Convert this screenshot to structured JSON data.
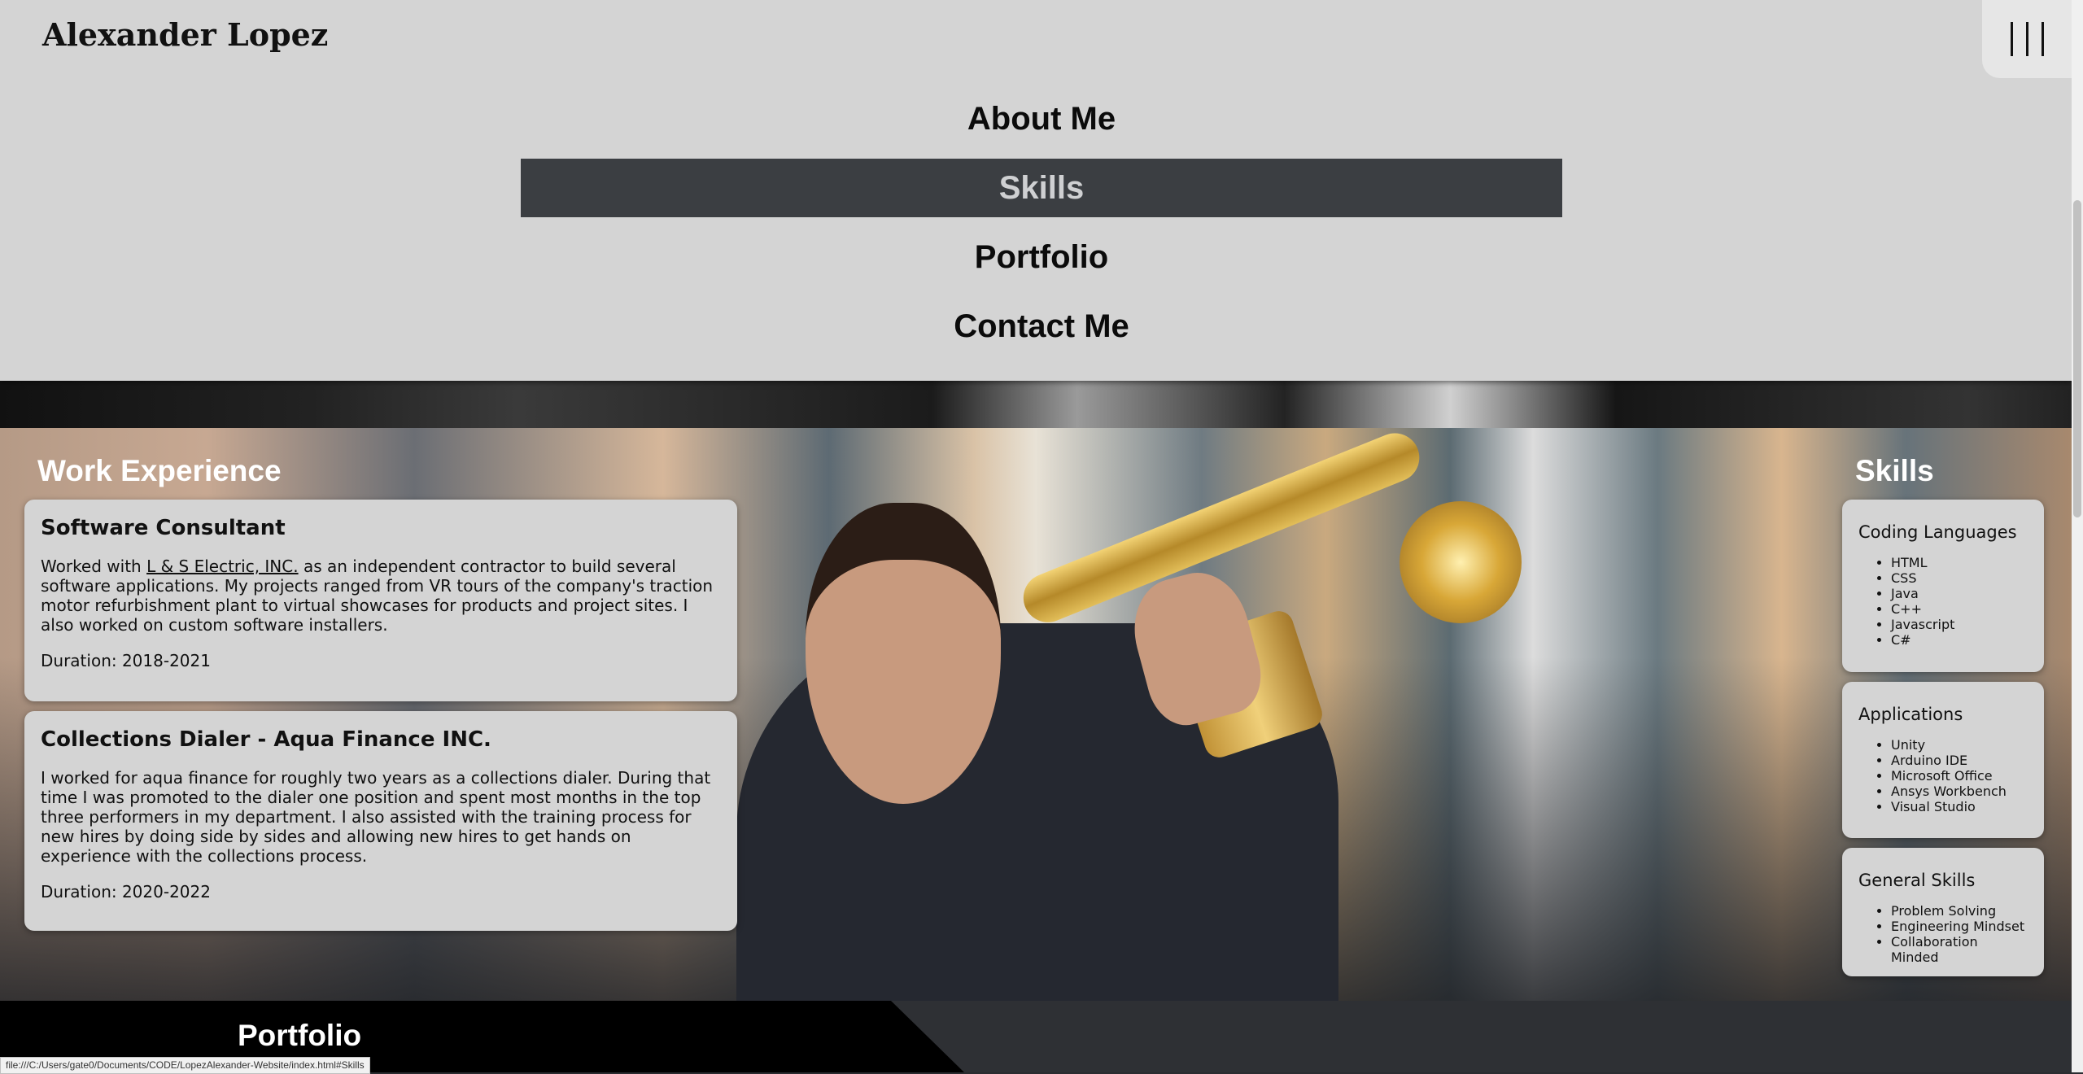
{
  "header": {
    "brand": "Alexander Lopez",
    "menu_icon": "hamburger-vertical-icon"
  },
  "nav": {
    "items": [
      {
        "label": "About Me"
      },
      {
        "label": "Skills",
        "active": true
      },
      {
        "label": "Portfolio"
      },
      {
        "label": "Contact Me"
      }
    ]
  },
  "work": {
    "title": "Work Experience",
    "jobs": [
      {
        "title": "Software Consultant",
        "desc_pre": "Worked with ",
        "company_link": "L & S Electric, INC.",
        "desc_post": " as an independent contractor to build several software applications. My projects ranged from VR tours of the company's traction motor refurbishment plant to virtual showcases for products and project sites. I also worked on custom software installers.",
        "duration": "Duration: 2018-2021"
      },
      {
        "title": "Collections Dialer - Aqua Finance INC.",
        "desc": "I worked for aqua finance for roughly two years as a collections dialer. During that time I was promoted to the dialer one position and spent most months in the top three performers in my department. I also assisted with the training process for new hires by doing side by sides and allowing new hires to get hands on experience with the collections process.",
        "duration": "Duration: 2020-2022"
      }
    ]
  },
  "skills": {
    "title": "Skills",
    "groups": [
      {
        "title": "Coding Languages",
        "items": [
          "HTML",
          "CSS",
          "Java",
          "C++",
          "Javascript",
          "C#"
        ]
      },
      {
        "title": "Applications",
        "items": [
          "Unity",
          "Arduino IDE",
          "Microsoft Office",
          "Ansys Workbench",
          "Visual Studio"
        ]
      },
      {
        "title": "General Skills",
        "items": [
          "Problem Solving",
          "Engineering Mindset",
          "Collaboration Minded"
        ]
      }
    ]
  },
  "portfolio": {
    "title": "Portfolio"
  },
  "status_bar": {
    "url": "file:///C:/Users/gate0/Documents/CODE/LopezAlexander-Website/index.html#Skills"
  }
}
